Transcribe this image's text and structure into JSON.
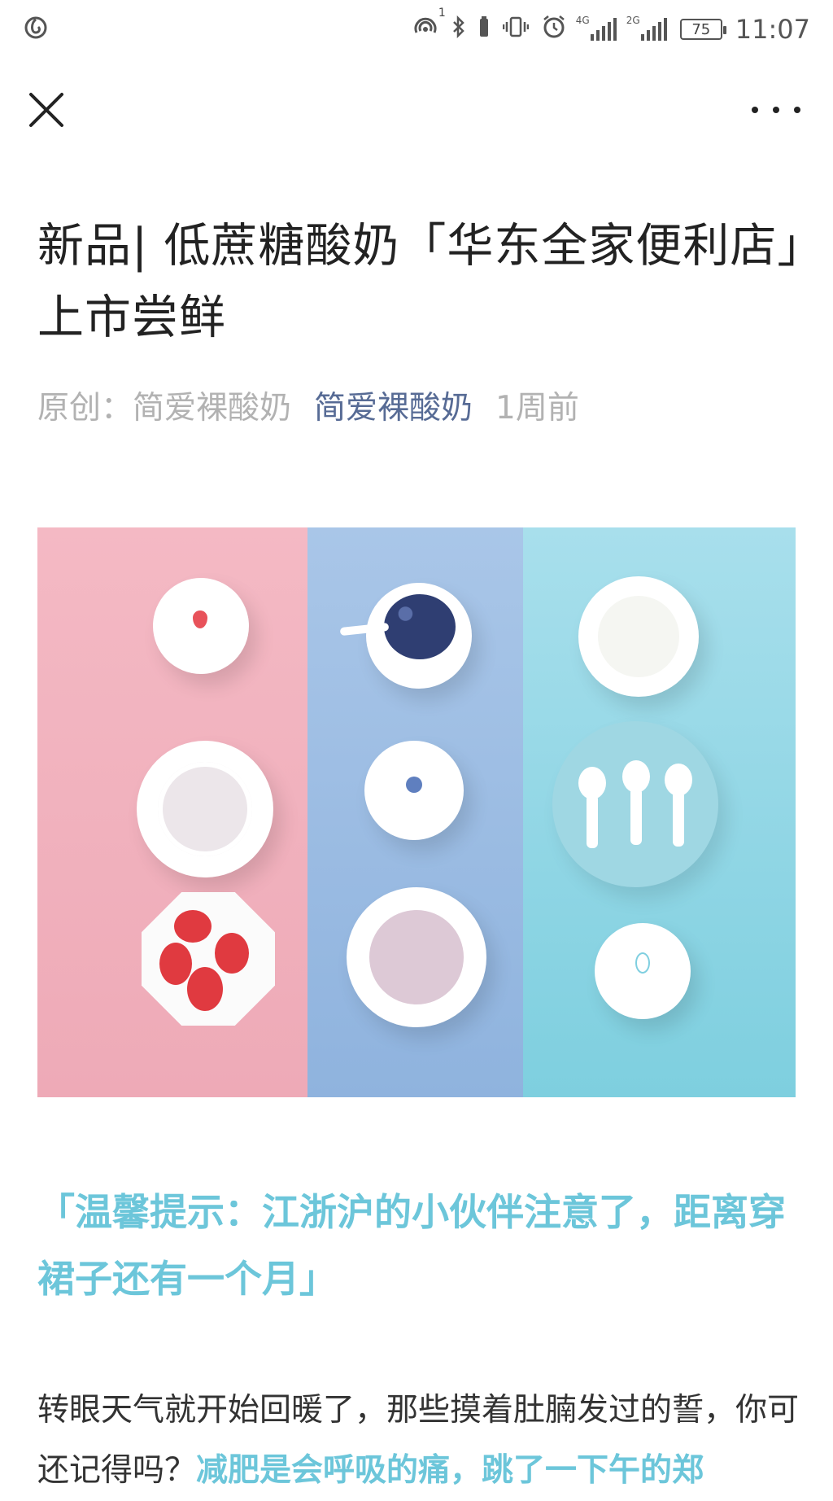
{
  "status_bar": {
    "sim1_label": "4G",
    "sim2_label": "2G",
    "hotspot_badge": "1",
    "battery": "75",
    "time": "11:07"
  },
  "nav": {
    "close_icon": "close-icon",
    "more_icon": "more-icon"
  },
  "article": {
    "title": "新品| 低蔗糖酸奶「华东全家便利店」上市尝鲜",
    "meta_prefix": "原创：简爱裸酸奶",
    "account_name": "简爱裸酸奶",
    "published": "1周前",
    "tip_heading": "「温馨提示：江浙沪的小伙伴注意了，距离穿裙子还有一个月」",
    "body_plain": "转眼天气就开始回暖了，那些摸着肚腩发过的誓，你可还记得吗？",
    "body_highlight": "减肥是会呼吸的痛，跳了一下午的郑"
  },
  "colors": {
    "accent_link": "#576b95",
    "highlight": "#6cc6da",
    "pink_panel": "#f0adb9",
    "blue_panel": "#9bbce2",
    "cyan_panel": "#8fd6e5"
  }
}
